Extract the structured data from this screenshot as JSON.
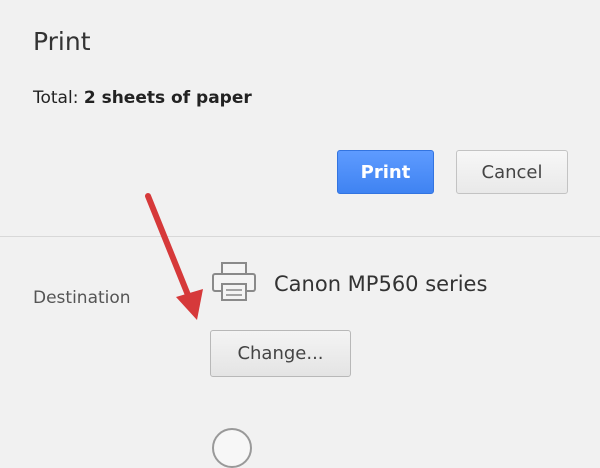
{
  "dialog": {
    "title": "Print",
    "total_label": "Total:",
    "total_value": "2 sheets of paper"
  },
  "actions": {
    "print_label": "Print",
    "cancel_label": "Cancel"
  },
  "destination": {
    "label": "Destination",
    "printer_name": "Canon MP560 series",
    "change_label": "Change...",
    "printer_icon": "printer-icon"
  },
  "annotation": {
    "arrow_color": "#d6393a",
    "arrow_icon": "red-arrow-icon"
  },
  "colors": {
    "accent": "#4285f4",
    "background": "#f1f1f1"
  }
}
